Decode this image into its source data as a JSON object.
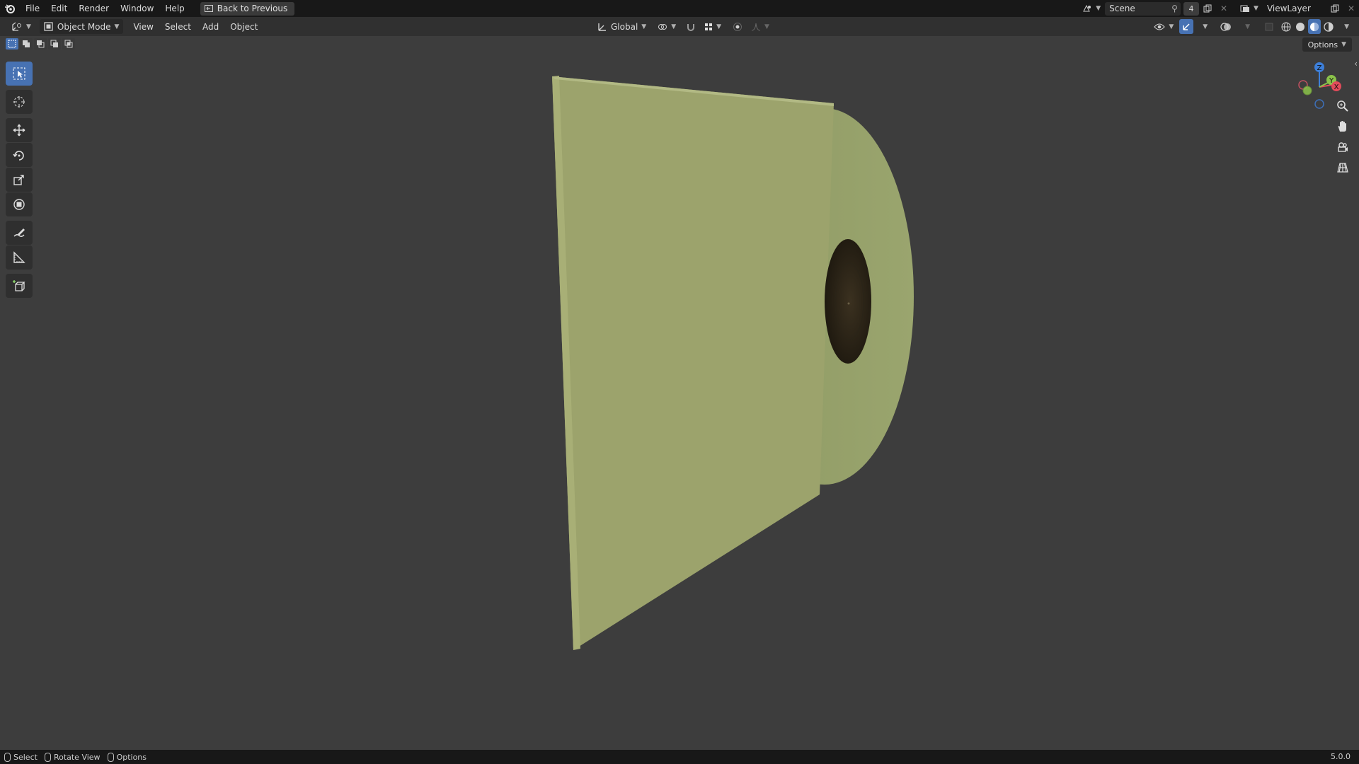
{
  "app": {
    "menus": [
      "File",
      "Edit",
      "Render",
      "Window",
      "Help"
    ],
    "back_label": "Back to Previous"
  },
  "top_right": {
    "scene": "Scene",
    "scene_users": "4",
    "view_layer": "ViewLayer"
  },
  "header": {
    "mode": "Object Mode",
    "menus": [
      "View",
      "Select",
      "Add",
      "Object"
    ],
    "transform_orientation": "Global"
  },
  "viewport": {
    "options_label": "Options",
    "gizmo_axes": [
      "Z",
      "Y",
      "X"
    ],
    "object_color": "#9aa56e"
  },
  "status": {
    "select": "Select",
    "rotate": "Rotate View",
    "options": "Options",
    "version": "5.0.0"
  },
  "colors": {
    "accent": "#4772b3",
    "axis_x": "#e14b5a",
    "axis_y": "#8bc34a",
    "axis_z": "#3d7fd9"
  }
}
